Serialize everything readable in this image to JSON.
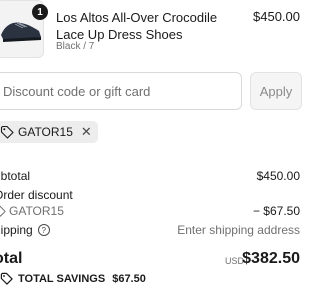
{
  "line_item": {
    "quantity": "1",
    "title": "Los Altos All-Over Crocodile Lace Up Dress Shoes",
    "variant": "Black / 7",
    "price": "$450.00"
  },
  "discount": {
    "placeholder": "Discount code or gift card",
    "apply_label": "Apply"
  },
  "applied_code": {
    "code": "GATOR15",
    "remove_glyph": "✕"
  },
  "summary": {
    "subtotal_label": "ubtotal",
    "subtotal_value": "$450.00",
    "order_discount_label": "Order discount",
    "discount_code": "GATOR15",
    "discount_value": "− $67.50",
    "shipping_label": "hipping",
    "shipping_info_glyph": "?",
    "shipping_value": "Enter shipping address",
    "total_label": "otal",
    "currency": "USD",
    "total_value": "$382.50",
    "savings_label": "TOTAL SAVINGS",
    "savings_value": "$67.50"
  },
  "icons": {
    "product": "shoe-thumbnail",
    "tag": "tag-icon",
    "close": "close-icon",
    "info": "info-icon",
    "savings": "tag-icon"
  }
}
